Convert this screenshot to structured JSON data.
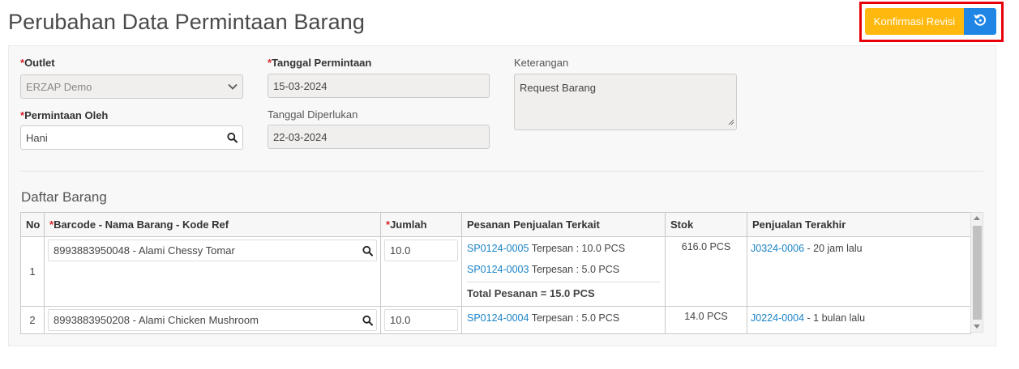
{
  "header": {
    "title": "Perubahan Data Permintaan Barang",
    "confirm_label": "Konfirmasi Revisi"
  },
  "form": {
    "required_mark": "*",
    "outlet": {
      "label": "Outlet",
      "value": "ERZAP Demo"
    },
    "requested_by": {
      "label": "Permintaan Oleh",
      "value": "Hani"
    },
    "request_date": {
      "label": "Tanggal Permintaan",
      "value": "15-03-2024"
    },
    "needed_date": {
      "label": "Tanggal Diperlukan",
      "value": "22-03-2024"
    },
    "notes": {
      "label": "Keterangan",
      "value": "Request Barang"
    }
  },
  "items_section": {
    "title": "Daftar Barang",
    "columns": {
      "no": "No",
      "barcode": "Barcode - Nama Barang - Kode Ref",
      "qty": "Jumlah",
      "sales_orders": "Pesanan Penjualan Terkait",
      "stock": "Stok",
      "last_sale": "Penjualan Terakhir"
    },
    "rows": [
      {
        "no": "1",
        "barcode": "8993883950048 - Alami Chessy Tomar",
        "qty": "10.0",
        "orders": [
          {
            "code": "SP0124-0005",
            "text": "Terpesan : 10.0 PCS"
          },
          {
            "code": "SP0124-0003",
            "text": "Terpesan : 5.0 PCS"
          }
        ],
        "total": "Total Pesanan = 15.0 PCS",
        "stock": "616.0 PCS",
        "last_sale_code": "J0324-0006",
        "last_sale_text": "- 20 jam lalu"
      },
      {
        "no": "2",
        "barcode": "8993883950208 - Alami Chicken Mushroom",
        "qty": "10.0",
        "orders": [
          {
            "code": "SP0124-0004",
            "text": "Terpesan : 5.0 PCS"
          }
        ],
        "stock": "14.0 PCS",
        "last_sale_code": "J0224-0004",
        "last_sale_text": "- 1 bulan lalu"
      }
    ]
  }
}
